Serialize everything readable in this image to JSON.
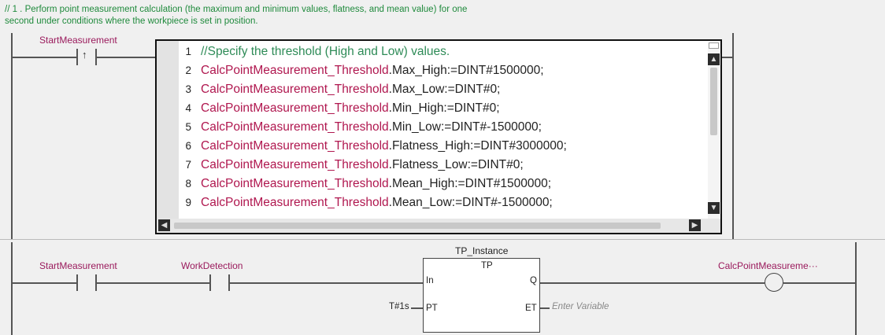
{
  "rung1": {
    "comment_line1": "// 1 .  Perform point measurement calculation (the maximum and minimum values, flatness, and mean value) for one",
    "comment_line2": "second under conditions where the workpiece is set in position.",
    "contact_label": "StartMeasurement",
    "contact_symbol": "↑"
  },
  "st_editor": {
    "lines": [
      {
        "num": "1",
        "comment": "//Specify the threshold (High and Low) values.",
        "obj": "",
        "member": ""
      },
      {
        "num": "2",
        "comment": "",
        "obj": "CalcPointMeasurement_Threshold",
        "member": ".Max_High:=DINT#1500000;"
      },
      {
        "num": "3",
        "comment": "",
        "obj": "CalcPointMeasurement_Threshold",
        "member": ".Max_Low:=DINT#0;"
      },
      {
        "num": "4",
        "comment": "",
        "obj": "CalcPointMeasurement_Threshold",
        "member": ".Min_High:=DINT#0;"
      },
      {
        "num": "5",
        "comment": "",
        "obj": "CalcPointMeasurement_Threshold",
        "member": ".Min_Low:=DINT#-1500000;"
      },
      {
        "num": "6",
        "comment": "",
        "obj": "CalcPointMeasurement_Threshold",
        "member": ".Flatness_High:=DINT#3000000;"
      },
      {
        "num": "7",
        "comment": "",
        "obj": "CalcPointMeasurement_Threshold",
        "member": ".Flatness_Low:=DINT#0;"
      },
      {
        "num": "8",
        "comment": "",
        "obj": "CalcPointMeasurement_Threshold",
        "member": ".Mean_High:=DINT#1500000;"
      },
      {
        "num": "9",
        "comment": "",
        "obj": "CalcPointMeasurement_Threshold",
        "member": ".Mean_Low:=DINT#-1500000;"
      }
    ],
    "scroll_up": "▲",
    "scroll_down": "▼",
    "scroll_left": "◀",
    "scroll_right": "▶"
  },
  "rung2": {
    "contact1_label": "StartMeasurement",
    "contact2_label": "WorkDetection",
    "fb_instance": "TP_Instance",
    "fb_type": "TP",
    "pin_in": "In",
    "pin_pt": "PT",
    "pin_q": "Q",
    "pin_et": "ET",
    "pt_value": "T#1s",
    "et_placeholder": "Enter Variable",
    "coil_label": "CalcPointMeasureme···"
  },
  "colors": {
    "comment": "#1f8a3c",
    "variable": "#9a1a5c",
    "st_object": "#b0174f",
    "st_comment": "#2e8b57"
  }
}
